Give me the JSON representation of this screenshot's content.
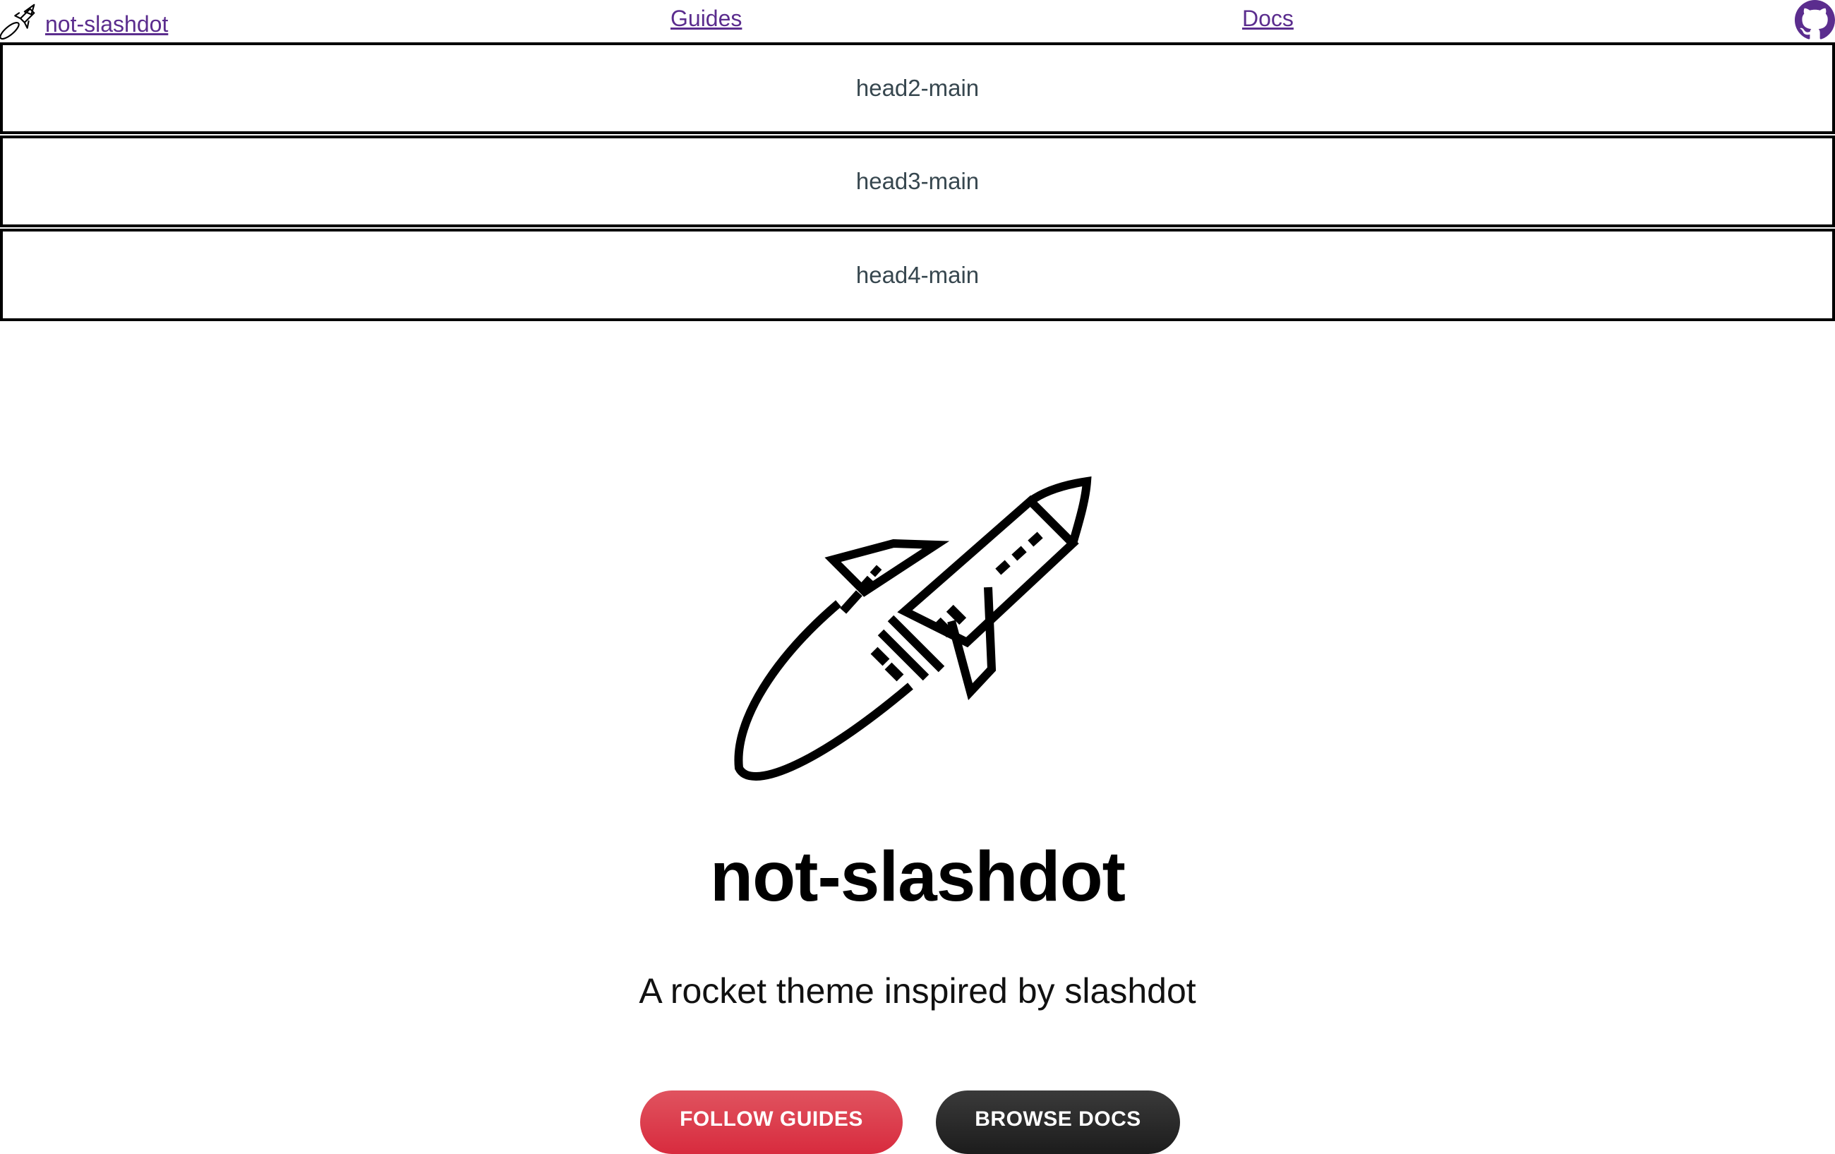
{
  "nav": {
    "brand_label": " not-slashdot",
    "guides_label": "Guides",
    "docs_label": "Docs",
    "github_icon": "github-icon",
    "link_color": "#5b2d8e"
  },
  "head_bars": [
    {
      "label": "head2-main"
    },
    {
      "label": "head3-main"
    },
    {
      "label": "head4-main"
    }
  ],
  "hero": {
    "title": "not-slashdot",
    "subtitle": "A rocket theme inspired by slashdot",
    "rocket_icon": "rocket-icon"
  },
  "buttons": {
    "follow_guides": "FOLLOW GUIDES",
    "browse_docs": "BROWSE DOCS",
    "follow_color": "#d82b3e",
    "browse_color": "#1c1c1c"
  }
}
